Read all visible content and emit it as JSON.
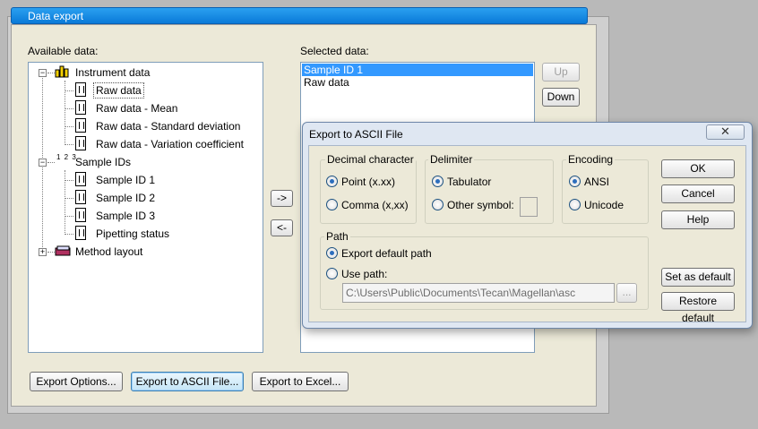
{
  "window": {
    "title": "Data export"
  },
  "available": {
    "label": "Available data:",
    "tree": [
      {
        "label": "Instrument data",
        "icon": "bar-chart-icon",
        "expander": "−"
      },
      {
        "label": "Raw data",
        "icon": "document-icon",
        "selected": true
      },
      {
        "label": "Raw data - Mean",
        "icon": "document-icon"
      },
      {
        "label": "Raw data - Standard deviation",
        "icon": "document-icon"
      },
      {
        "label": "Raw data - Variation coefficient",
        "icon": "document-icon"
      },
      {
        "label": "Sample IDs",
        "icon": "numbered-list-icon",
        "expander": "−"
      },
      {
        "label": "Sample ID 1",
        "icon": "document-icon"
      },
      {
        "label": "Sample ID 2",
        "icon": "document-icon"
      },
      {
        "label": "Sample ID 3",
        "icon": "document-icon"
      },
      {
        "label": "Pipetting status",
        "icon": "document-icon"
      },
      {
        "label": "Method layout",
        "icon": "book-icon",
        "expander": "+"
      }
    ],
    "sample_ids_icon_text": "1 2 3"
  },
  "transfer": {
    "add_label": "->",
    "remove_label": "<-"
  },
  "selected": {
    "label": "Selected data:",
    "items": [
      "Sample ID 1",
      "Raw data"
    ],
    "up_label": "Up",
    "down_label": "Down"
  },
  "footer": {
    "export_options": "Export Options...",
    "export_ascii": "Export to ASCII File...",
    "export_excel": "Export to Excel..."
  },
  "dialog": {
    "title": "Export to ASCII File",
    "close_glyph": "✕",
    "decimal": {
      "title": "Decimal character",
      "option1": "Point (x.xx)",
      "option2": "Comma (x,xx)",
      "selected": "Point (x.xx)"
    },
    "delimiter": {
      "title": "Delimiter",
      "option1": "Tabulator",
      "option2": "Other symbol:",
      "selected": "Tabulator",
      "symbol_value": ""
    },
    "encoding": {
      "title": "Encoding",
      "option1": "ANSI",
      "option2": "Unicode",
      "selected": "ANSI"
    },
    "path": {
      "title": "Path",
      "option1": "Export default path",
      "option2": "Use path:",
      "selected": "Export default path",
      "value": "C:\\Users\\Public\\Documents\\Tecan\\Magellan\\asc",
      "browse_label": "..."
    },
    "buttons": {
      "ok": "OK",
      "cancel": "Cancel",
      "help": "Help",
      "set_default": "Set as default",
      "restore_default": "Restore default"
    }
  },
  "colors": {
    "titlebar": "#0a7ad8",
    "selection": "#3399ff",
    "panel": "#ece9d8"
  }
}
